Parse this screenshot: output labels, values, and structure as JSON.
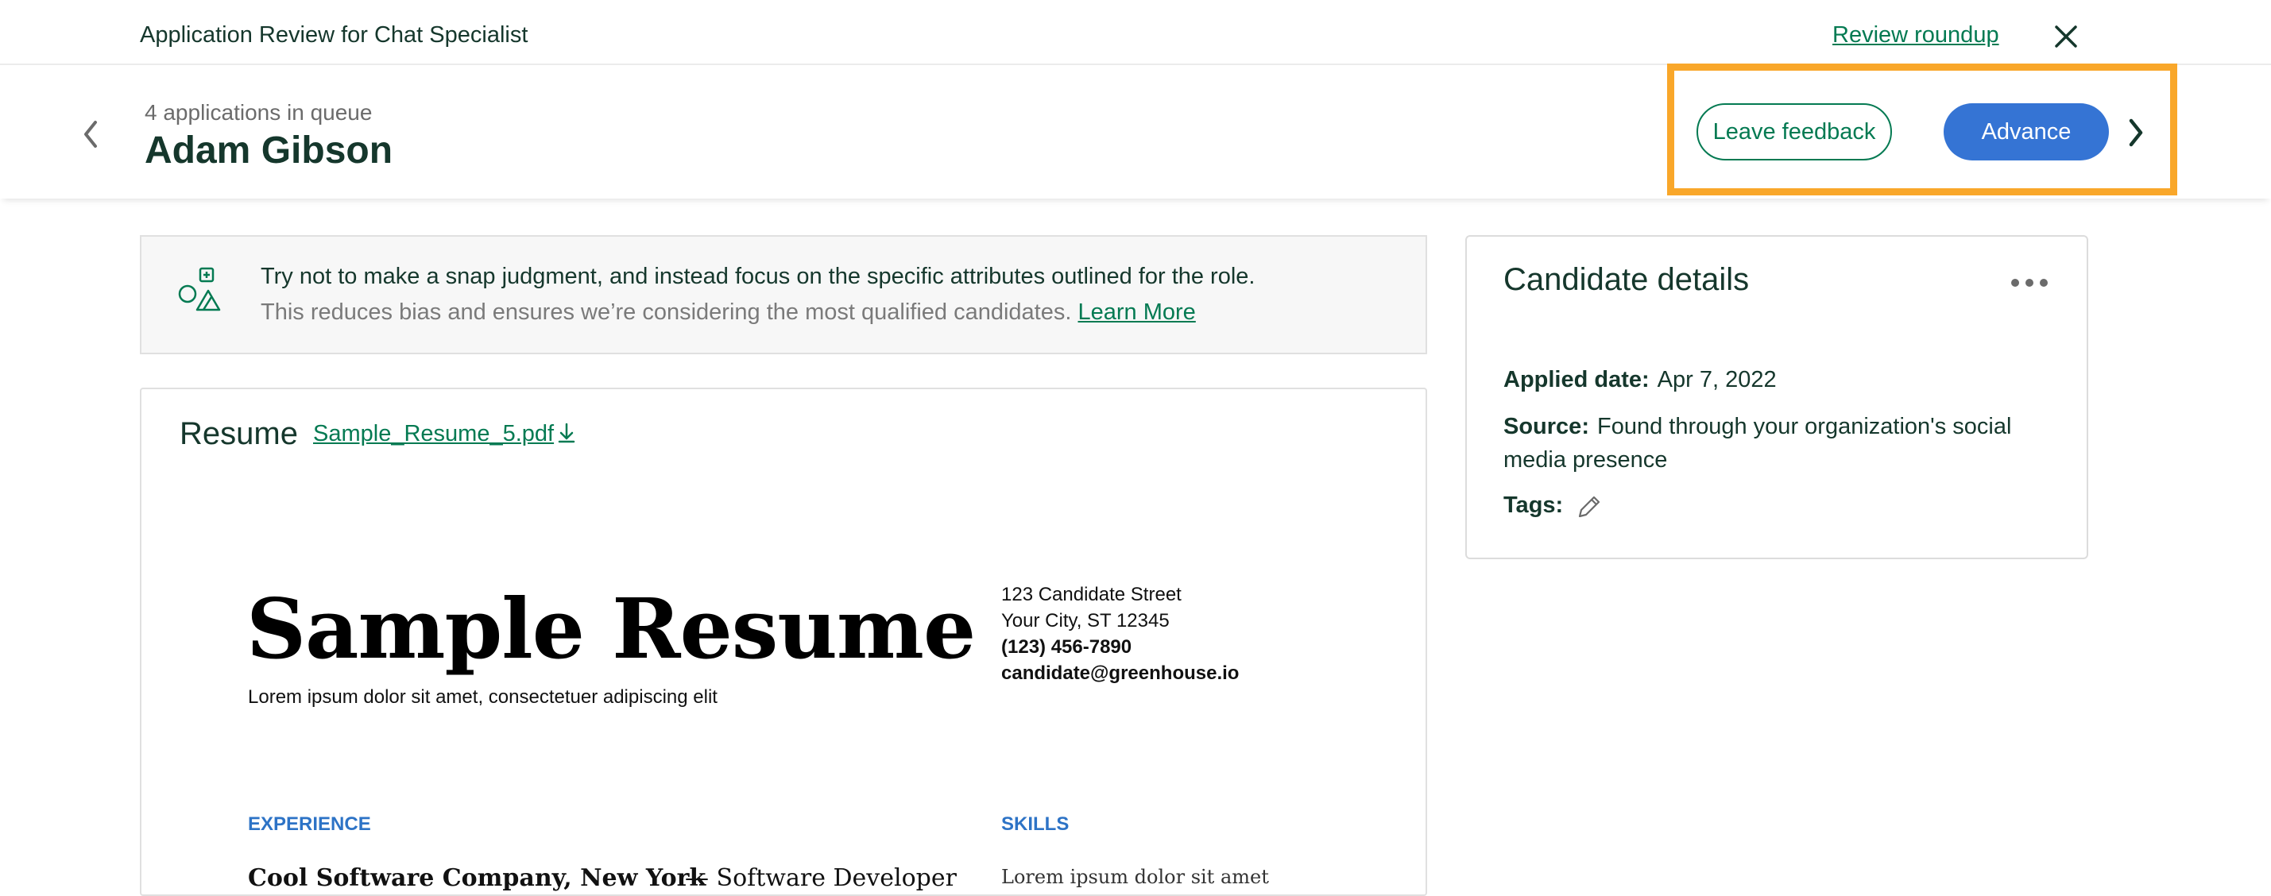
{
  "topbar": {
    "title": "Application Review for Chat Specialist",
    "review_roundup": "Review roundup",
    "close_icon": "close-icon"
  },
  "header": {
    "queue_text": "4 applications in queue",
    "candidate_name": "Adam Gibson",
    "leave_feedback": "Leave feedback",
    "advance": "Advance",
    "colors": {
      "accent_green": "#047a52",
      "advance_blue": "#3574d4",
      "highlight_orange": "#f9a72a"
    }
  },
  "tip": {
    "line1": "Try not to make a snap judgment, and instead focus on the specific attributes outlined for the role.",
    "line2": "This reduces bias and ensures we’re considering the most qualified candidates.",
    "learn_more": "Learn More"
  },
  "resume": {
    "label": "Resume",
    "file_name": "Sample_Resume_5.pdf",
    "doc": {
      "title": "Sample Resume",
      "subtitle": "Lorem ipsum dolor sit amet, consectetuer adipiscing elit",
      "address1": "123 Candidate Street",
      "address2": "Your City, ST 12345",
      "phone": "(123) 456-7890",
      "email": "candidate@greenhouse.io",
      "experience_heading": "EXPERIENCE",
      "skills_heading": "SKILLS",
      "experience_company": "Cool Software Company, New York",
      "experience_role": "— Software Developer",
      "skills_first": "Lorem ipsum dolor sit amet"
    }
  },
  "details": {
    "title": "Candidate details",
    "applied_label": "Applied date:",
    "applied_value": "Apr 7, 2022",
    "source_label": "Source:",
    "source_value": "Found through your organization's social media presence",
    "tags_label": "Tags:"
  }
}
